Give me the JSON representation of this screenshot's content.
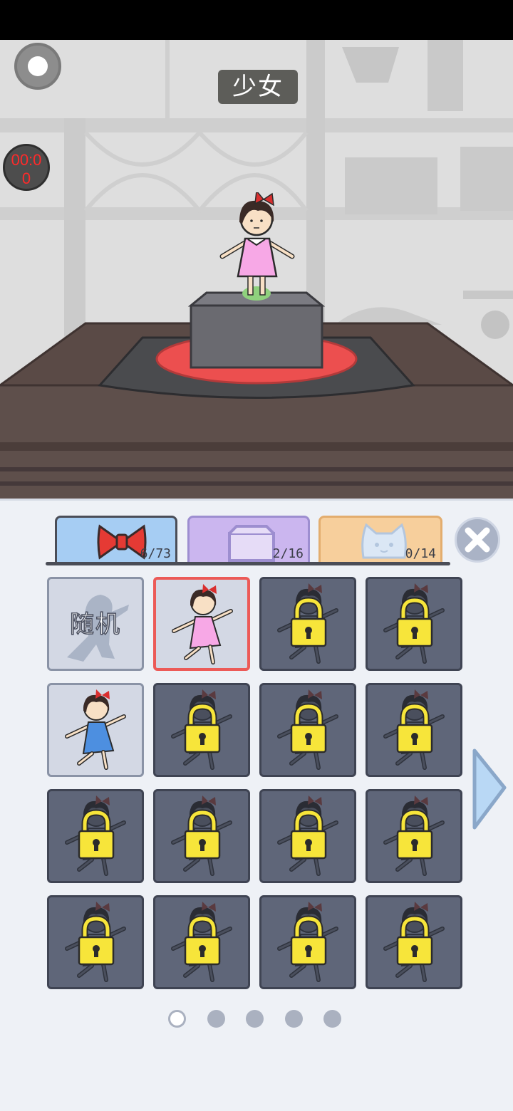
{
  "header": {
    "title": "少女",
    "timer_line1": "00:0",
    "timer_line2": "0"
  },
  "tabs": [
    {
      "icon": "bow-icon",
      "count": "6/73"
    },
    {
      "icon": "box-icon",
      "count": "2/16"
    },
    {
      "icon": "cat-icon",
      "count": "0/14"
    }
  ],
  "grid": {
    "random_label": "随机",
    "cells": [
      {
        "type": "random"
      },
      {
        "type": "outfit",
        "dress": "pink",
        "locked": false,
        "selected": true
      },
      {
        "type": "outfit",
        "locked": true
      },
      {
        "type": "outfit",
        "locked": true
      },
      {
        "type": "outfit",
        "dress": "blue",
        "locked": false,
        "selected": false
      },
      {
        "type": "outfit",
        "locked": true
      },
      {
        "type": "outfit",
        "locked": true
      },
      {
        "type": "outfit",
        "locked": true
      },
      {
        "type": "outfit",
        "locked": true
      },
      {
        "type": "outfit",
        "locked": true
      },
      {
        "type": "outfit",
        "locked": true
      },
      {
        "type": "outfit",
        "locked": true
      },
      {
        "type": "outfit",
        "locked": true
      },
      {
        "type": "outfit",
        "locked": true
      },
      {
        "type": "outfit",
        "locked": true
      },
      {
        "type": "outfit",
        "locked": true
      }
    ]
  },
  "pagination": {
    "pages": 5,
    "current": 1
  },
  "colors": {
    "selected_border": "#ec5a57",
    "lock": "#f7e53a",
    "timer_text": "#ff2a2a"
  }
}
